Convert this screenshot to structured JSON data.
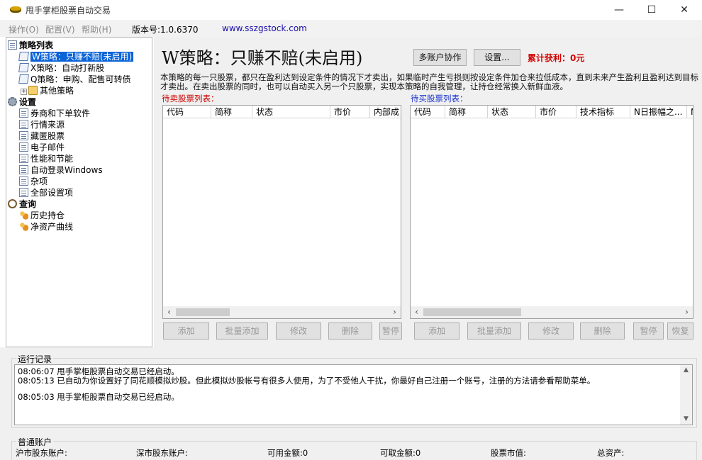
{
  "window": {
    "title": "甩手掌柜股票自动交易",
    "controls": [
      "—",
      "☐",
      "✕"
    ]
  },
  "menubar": {
    "items": [
      "操作(O)",
      "配置(V)",
      "帮助(H)"
    ],
    "version": "版本号:1.0.6370",
    "url": "www.sszgstock.com"
  },
  "tree": {
    "strategy_header": "策略列表",
    "strategies": [
      "W策略：只赚不赔(未启用)",
      "X策略：自动打新股",
      "Q策略：申购、配售可转债",
      "其他策略"
    ],
    "settings_header": "设置",
    "settings": [
      "券商和下单软件",
      "行情来源",
      "藏匿股票",
      "电子邮件",
      "性能和节能",
      "自动登录Windows",
      "杂项",
      "全部设置项"
    ],
    "query_header": "查询",
    "queries": [
      "历史持仓",
      "净资产曲线"
    ]
  },
  "main": {
    "title": "W策略：只赚不赔(未启用)",
    "btn_multi": "多账户协作",
    "btn_settings": "设置...",
    "profit": "累计获利：0元",
    "description": "本策略的每一只股票，都只在盈利达到设定条件的情况下才卖出，如果临时产生亏损则按设定条件加仓来拉低成本，直到未来产生盈利且盈利达到目标才卖出。在卖出股票的同时，也可以自动买入另一个只股票，实现本策略的自我管理，让持仓经常换入新鲜血液。",
    "sell_label": "待卖股票列表：",
    "buy_label": "待买股票列表：",
    "sell_columns": [
      "代码",
      "简称",
      "状态",
      "市价",
      "内部成"
    ],
    "buy_columns": [
      "代码",
      "简称",
      "状态",
      "市价",
      "技术指标",
      "N日振幅之...",
      "N"
    ],
    "sell_buttons": [
      "添加",
      "批量添加",
      "修改",
      "删除",
      "暂停"
    ],
    "buy_buttons": [
      "添加",
      "批量添加",
      "修改",
      "删除",
      "暂停",
      "恢复"
    ]
  },
  "log": {
    "group_title": "运行记录",
    "lines": [
      "08:06:07 甩手掌柜股票自动交易已经启动。",
      "08:05:13 已自动为你设置好了同花顺模拟炒股。但此模拟炒股帐号有很多人使用，为了不受他人干扰，你最好自己注册一个账号，注册的方法请参看帮助菜单。",
      "",
      "08:05:03 甩手掌柜股票自动交易已经启动。"
    ]
  },
  "account": {
    "group_title": "普通账户",
    "sh_label": "沪市股东账户:",
    "sz_label": "深市股东账户:",
    "available_label": "可用金额:0",
    "withdrawable_label": "可取金额:0",
    "market_value_label": "股票市值:",
    "total_assets_label": "总资产:"
  }
}
